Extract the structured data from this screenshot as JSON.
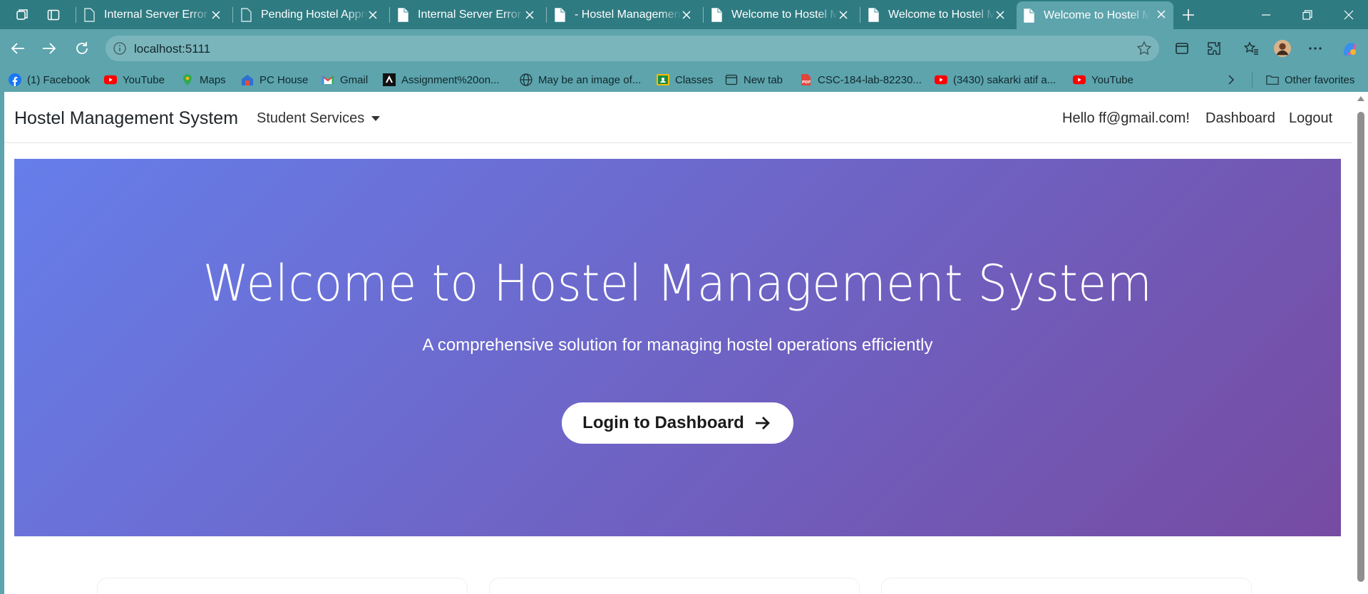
{
  "browser": {
    "tabs": [
      {
        "title": "Internal Server Error",
        "active": false
      },
      {
        "title": "Pending Hostel Approvals",
        "active": false
      },
      {
        "title": "Internal Server Error",
        "active": false
      },
      {
        "title": "- Hostel Management System",
        "active": false
      },
      {
        "title": "Welcome to Hostel Management System",
        "active": false
      },
      {
        "title": "Welcome to Hostel Management System",
        "active": false
      },
      {
        "title": "Welcome to Hostel Management System",
        "active": true
      }
    ],
    "url": "localhost:5111",
    "bookmarks": [
      {
        "label": "(1) Facebook",
        "icon": "facebook-icon"
      },
      {
        "label": "YouTube",
        "icon": "youtube-icon"
      },
      {
        "label": "Maps",
        "icon": "maps-icon"
      },
      {
        "label": "PC House",
        "icon": "pc-house-icon"
      },
      {
        "label": "Gmail",
        "icon": "gmail-icon"
      },
      {
        "label": "Assignment%20on...",
        "icon": "assignment-icon"
      },
      {
        "label": "May be an image of...",
        "icon": "globe-icon"
      },
      {
        "label": "Classes",
        "icon": "classroom-icon"
      },
      {
        "label": "New tab",
        "icon": "new-tab-icon"
      },
      {
        "label": "CSC-184-lab-82230...",
        "icon": "pdf-icon"
      },
      {
        "label": "(3430) sakarki atif a...",
        "icon": "youtube-icon"
      },
      {
        "label": "YouTube",
        "icon": "youtube-icon"
      }
    ],
    "other_favorites": "Other favorites",
    "colors": {
      "tabbar": "#2f7b82",
      "toolbar": "#5da4ad"
    }
  },
  "navbar": {
    "brand": "Hostel Management System",
    "menu_label": "Student Services",
    "greeting": "Hello ff@gmail.com!",
    "dashboard": "Dashboard",
    "logout": "Logout"
  },
  "hero": {
    "title": "Welcome to Hostel Management System",
    "subtitle": "A comprehensive solution for managing hostel operations efficiently",
    "cta_label": "Login to Dashboard",
    "gradient_start": "#667eea",
    "gradient_end": "#764ba2"
  }
}
